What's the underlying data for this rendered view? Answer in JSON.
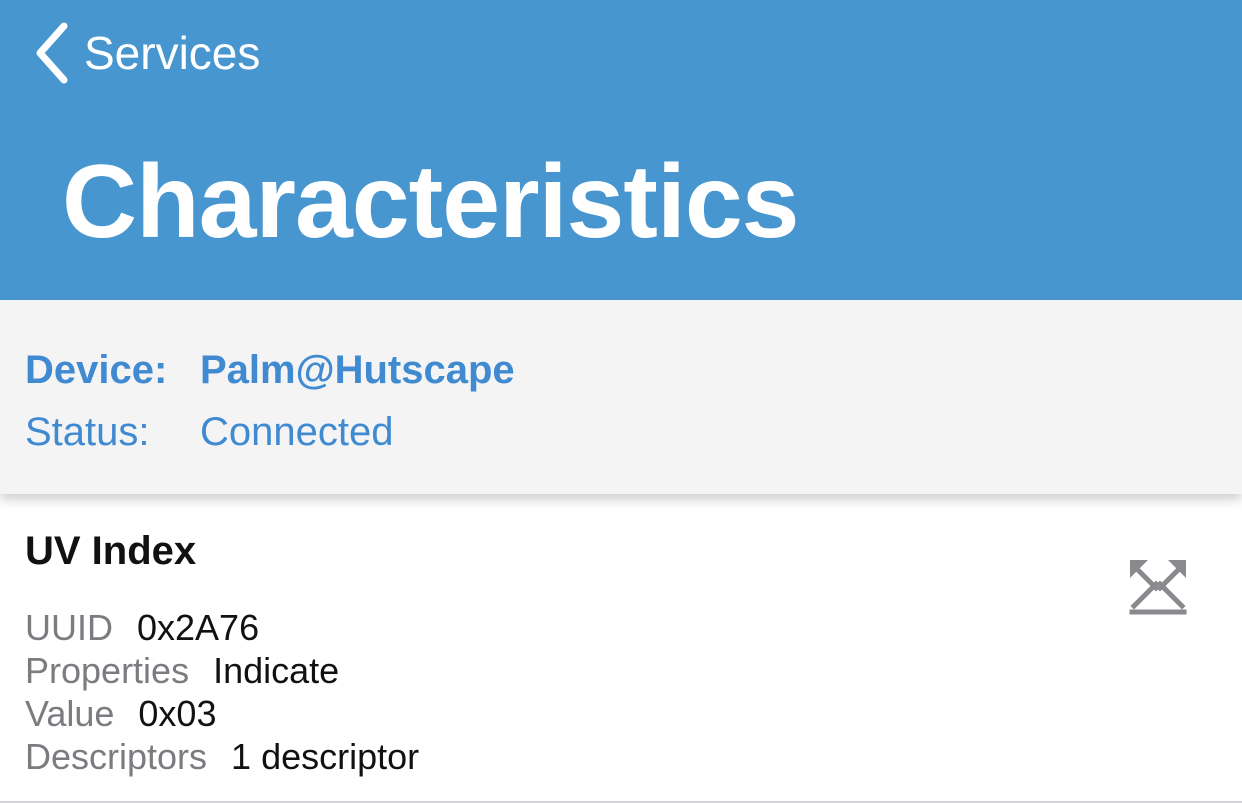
{
  "nav": {
    "back_label": "Services",
    "title": "Characteristics"
  },
  "device_info": {
    "device_label": "Device:",
    "device_name": "Palm@Hutscape",
    "status_label": "Status:",
    "status_value": "Connected"
  },
  "characteristic": {
    "name": "UV Index",
    "uuid_label": "UUID",
    "uuid_value": "0x2A76",
    "properties_label": "Properties",
    "properties_value": "Indicate",
    "value_label": "Value",
    "value_value": "0x03",
    "descriptors_label": "Descriptors",
    "descriptors_value": "1 descriptor",
    "action_icon": "indicate-arrows-icon"
  },
  "colors": {
    "header_bg": "#4796cf",
    "accent_text": "#3f8ad0",
    "panel_bg": "#f4f4f5",
    "secondary_text": "#7b7b80",
    "icon_gray": "#8a8a8e"
  }
}
